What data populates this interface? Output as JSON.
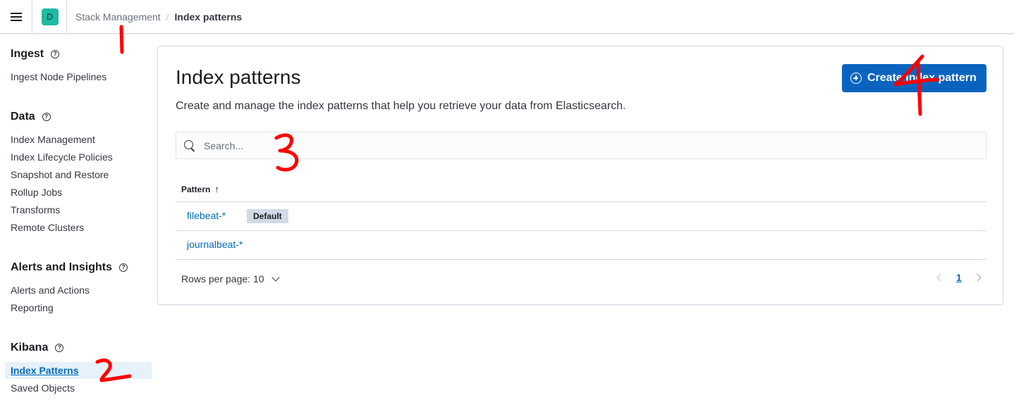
{
  "header": {
    "space_initial": "D",
    "breadcrumb_parent": "Stack Management",
    "breadcrumb_separator": "/",
    "breadcrumb_current": "Index patterns"
  },
  "sidebar": {
    "help_glyph": "?",
    "sections": [
      {
        "title": "Ingest",
        "items": [
          "Ingest Node Pipelines"
        ]
      },
      {
        "title": "Data",
        "items": [
          "Index Management",
          "Index Lifecycle Policies",
          "Snapshot and Restore",
          "Rollup Jobs",
          "Transforms",
          "Remote Clusters"
        ]
      },
      {
        "title": "Alerts and Insights",
        "items": [
          "Alerts and Actions",
          "Reporting"
        ]
      },
      {
        "title": "Kibana",
        "items": [
          "Index Patterns",
          "Saved Objects"
        ]
      }
    ],
    "active_item": "Index Patterns"
  },
  "main": {
    "title": "Index patterns",
    "description": "Create and manage the index patterns that help you retrieve your data from Elasticsearch.",
    "create_button": "Create index pattern",
    "search_placeholder": "Search...",
    "table": {
      "column": "Pattern",
      "sort_glyph": "↑",
      "rows": [
        {
          "pattern": "filebeat-*",
          "badge": "Default"
        },
        {
          "pattern": "journalbeat-*"
        }
      ]
    },
    "rows_per_page": "Rows per page: 10",
    "current_page": "1"
  },
  "annotations": {
    "color": "#ff0000",
    "labels": [
      "1",
      "2",
      "3",
      "4"
    ]
  }
}
